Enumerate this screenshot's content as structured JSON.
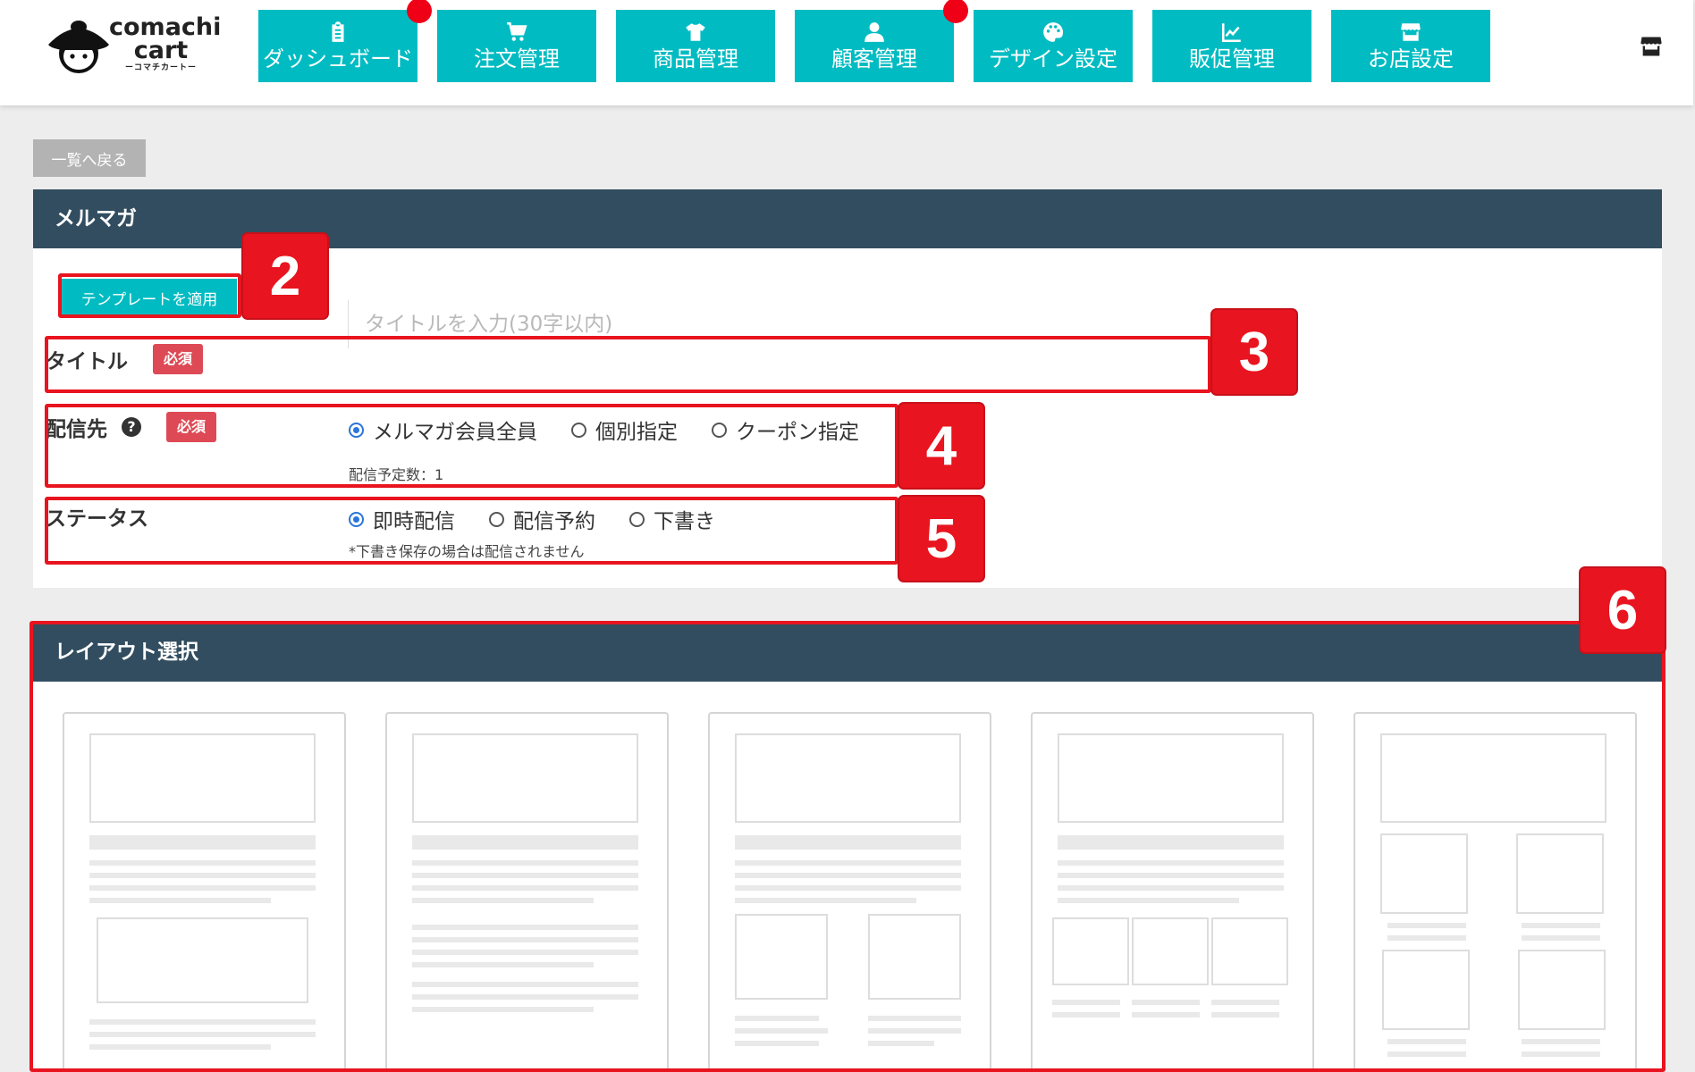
{
  "logo": {
    "line1": "comachi",
    "line2": "cart",
    "line3": "ーコマチカートー"
  },
  "nav": [
    {
      "label": "ダッシュボード",
      "icon": "clipboard-icon",
      "dot": true
    },
    {
      "label": "注文管理",
      "icon": "cart-icon",
      "dot": false
    },
    {
      "label": "商品管理",
      "icon": "tshirt-icon",
      "dot": false
    },
    {
      "label": "顧客管理",
      "icon": "user-icon",
      "dot": true
    },
    {
      "label": "デザイン設定",
      "icon": "palette-icon",
      "dot": false
    },
    {
      "label": "販促管理",
      "icon": "chart-line-icon",
      "dot": false
    },
    {
      "label": "お店設定",
      "icon": "store-icon",
      "dot": false
    }
  ],
  "back_label": "一覧へ戻る",
  "mailmag": {
    "heading": "メルマガ",
    "template_button": "テンプレートを適用",
    "title_label": "タイトル",
    "required": "必須",
    "title_placeholder": "タイトルを入力(30字以内)",
    "dest_label": "配信先",
    "dest_options": [
      "メルマガ会員全員",
      "個別指定",
      "クーポン指定"
    ],
    "dest_count": "配信予定数：1",
    "status_label": "ステータス",
    "status_options": [
      "即時配信",
      "配信予約",
      "下書き"
    ],
    "status_note": "*下書き保存の場合は配信されません"
  },
  "layout": {
    "heading": "レイアウト選択"
  },
  "annotations": [
    "2",
    "3",
    "4",
    "5",
    "6"
  ],
  "colors": {
    "accent": "#00bcc2",
    "panel_head": "#324d60",
    "highlight": "#e8141f",
    "required": "#dd4a55"
  }
}
